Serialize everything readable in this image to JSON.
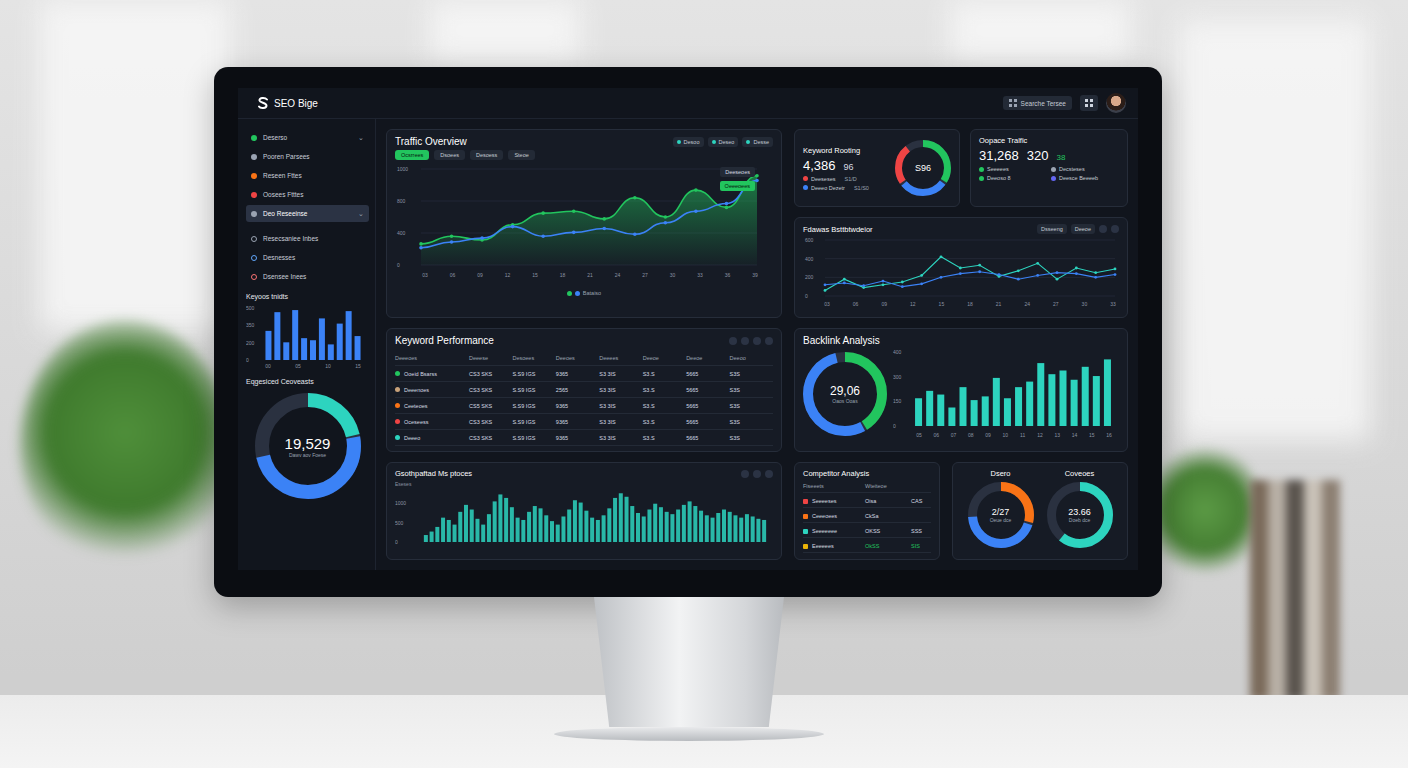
{
  "header": {
    "logo": "SEO Bige",
    "search": "Searche Tersee"
  },
  "sidebar": {
    "nav": [
      {
        "label": "Deserso",
        "color": "#22c55e",
        "selected": false,
        "chevron": "⌄"
      },
      {
        "label": "Pooren Parsees",
        "color": "#9aa3b2",
        "selected": false
      },
      {
        "label": "Reseen Fttes",
        "color": "#f97316",
        "selected": false
      },
      {
        "label": "Oosees Ftttes",
        "color": "#ef4444",
        "selected": false
      },
      {
        "label": "Deo Reseeinse",
        "color": "#9aa3b2",
        "selected": true,
        "chevron": "⌄"
      }
    ],
    "subnav": [
      {
        "label": "Resecsaniee Inbes",
        "color": "#9aa3b2",
        "selected": false
      },
      {
        "label": "Desnesses",
        "color": "#60a5fa",
        "selected": false
      },
      {
        "label": "Dsensee Inees",
        "color": "#f87171",
        "selected": false
      }
    ],
    "keyword_trends": {
      "title": "Keyoos tnidts",
      "y_ticks": [
        "500",
        "350",
        "200",
        "0"
      ],
      "max": 500,
      "values": [
        280,
        460,
        170,
        480,
        210,
        190,
        400,
        150,
        350,
        470,
        230
      ],
      "x_labels": [
        "00",
        "05",
        "10",
        "15"
      ]
    },
    "engaged": {
      "title": "Eqgesiced Ceoveasts",
      "value": "19,529",
      "caption": "Dawv aov Foese",
      "segments": [
        {
          "level": 0.22,
          "color": "#2dd4bf"
        },
        {
          "level": 0.5,
          "color": "#3b82f6"
        }
      ]
    }
  },
  "traffic": {
    "title": "Traffic Overview",
    "tabs": [
      {
        "label": "Ocsrrees",
        "selected": true
      },
      {
        "label": "Dsoees",
        "selected": false
      },
      {
        "label": "Desoess",
        "selected": false
      },
      {
        "label": "Steoe",
        "selected": false
      }
    ],
    "chips": [
      "Desoo",
      "Deseo",
      "Desse"
    ],
    "y_ticks": [
      "1000",
      "800",
      "400",
      "0"
    ],
    "max": 1000,
    "x_labels": [
      "03",
      "06",
      "09",
      "12",
      "15",
      "18",
      "21",
      "24",
      "27",
      "30",
      "33",
      "36",
      "39"
    ],
    "series": [
      {
        "color": "#22c55e",
        "values": [
          220,
          300,
          260,
          420,
          540,
          560,
          480,
          700,
          500,
          780,
          600,
          930
        ]
      },
      {
        "color": "#3b82f6",
        "values": [
          180,
          240,
          280,
          400,
          300,
          340,
          380,
          320,
          440,
          560,
          640,
          880
        ]
      }
    ],
    "tooltip": {
      "label": "Deeseoes",
      "badge": "Oeeeoees"
    },
    "legend": "Bataiso"
  },
  "keyword_ranking": {
    "title": "Keyword Rooting",
    "value": "4,386",
    "delta": "96",
    "rows": [
      {
        "label": "Deeseses",
        "value": "S1/D",
        "color": "#ef4444"
      },
      {
        "label": "Deeeo Dezetr",
        "value": "S1/S0",
        "color": "#3b82f6"
      }
    ],
    "gauge": {
      "value": "S96",
      "segments": [
        {
          "level": 0.35,
          "color": "#22c55e"
        },
        {
          "level": 0.3,
          "color": "#3b82f6"
        },
        {
          "level": 0.25,
          "color": "#ef4444"
        }
      ]
    }
  },
  "organic": {
    "title": "Oopace Tralfic",
    "value": "31,268",
    "sub": "320",
    "delta": "38",
    "rows": [
      {
        "label": "Seeeees",
        "color": "#22c55e"
      },
      {
        "label": "Decsteses",
        "color": "#9aa3b2"
      },
      {
        "label": "Deeoso 8",
        "color": "#22c55e"
      },
      {
        "label": "Deesce Beeeeb",
        "color": "#6366f1"
      }
    ]
  },
  "behavior": {
    "title": "Fdawas Bsttbtwdeior",
    "chips": [
      "Dsseeng",
      "Deeoe"
    ],
    "y_ticks": [
      "600",
      "400",
      "200",
      "0"
    ],
    "max": 600,
    "x_labels": [
      "03",
      "06",
      "09",
      "12",
      "15",
      "18",
      "21",
      "24",
      "27",
      "30",
      "33"
    ],
    "series": [
      {
        "color": "#2dd4bf",
        "values": [
          60,
          180,
          90,
          120,
          150,
          220,
          420,
          300,
          330,
          210,
          270,
          350,
          180,
          300,
          250,
          290
        ]
      },
      {
        "color": "#3b82f6",
        "values": [
          120,
          140,
          110,
          160,
          100,
          130,
          200,
          240,
          260,
          230,
          180,
          220,
          250,
          240,
          200,
          230
        ]
      }
    ]
  },
  "keyword_performance": {
    "title": "Keyword Performance",
    "columns": [
      "Deeeoes",
      "Deeese",
      "Desoees",
      "Deeoes",
      "Deeees",
      "Deeoe",
      "Deeoe",
      "Deeoo"
    ],
    "rows": [
      {
        "color": "#22c55e",
        "cells": [
          "Ooeid Bsarss",
          "CS3 SKS",
          "S.S9 IGS",
          "9365",
          "S3 3IS",
          "S3.S",
          "5665",
          "S3S"
        ]
      },
      {
        "color": "#c8a27a",
        "cells": [
          "Deeenoes",
          "CS3 SKS",
          "S.S9 IGS",
          "2565",
          "S3 3IS",
          "S3.S",
          "5665",
          "S3S"
        ]
      },
      {
        "color": "#f97316",
        "cells": [
          "Ceeteoes",
          "CS5 SKS",
          "S.S9 IGS",
          "9365",
          "S3 3IS",
          "S3.S",
          "5665",
          "S3S"
        ]
      },
      {
        "color": "#ef4444",
        "cells": [
          "Oceseess",
          "CS3 SKS",
          "S.S9 IGS",
          "9365",
          "S3 3IS",
          "S3.S",
          "5665",
          "S3S"
        ]
      },
      {
        "color": "#2dd4bf",
        "cells": [
          "Deeeo",
          "CS3 SKS",
          "S.S9 IGS",
          "9365",
          "S3 3IS",
          "S3.S",
          "5665",
          "S3S"
        ]
      }
    ]
  },
  "backlinks": {
    "title": "Backlink Analysis",
    "donut": {
      "value": "29,06",
      "caption": "Oaos Ooas",
      "segments": [
        {
          "level": 0.42,
          "color": "#22c55e"
        },
        {
          "level": 0.55,
          "color": "#3b82f6"
        }
      ]
    },
    "y_ticks": [
      "400",
      "300",
      "150",
      "0"
    ],
    "max": 400,
    "values": [
      150,
      190,
      170,
      100,
      210,
      140,
      160,
      260,
      150,
      210,
      240,
      340,
      280,
      300,
      250,
      320,
      270,
      360
    ],
    "x_labels": [
      "05",
      "06",
      "07",
      "08",
      "09",
      "10",
      "11",
      "12",
      "13",
      "14",
      "15",
      "16"
    ]
  },
  "visibility": {
    "title": "Gsothpaftad Ms ptoces",
    "y_ticks": [
      "Eseses",
      "1000",
      "500",
      "0"
    ],
    "max": 1000,
    "values": [
      120,
      180,
      260,
      420,
      380,
      300,
      520,
      640,
      560,
      400,
      300,
      480,
      700,
      820,
      760,
      600,
      420,
      380,
      520,
      620,
      580,
      460,
      360,
      300,
      440,
      560,
      720,
      680,
      540,
      420,
      380,
      460,
      580,
      760,
      840,
      780,
      620,
      500,
      440,
      560,
      660,
      600,
      520,
      480,
      560,
      640,
      700,
      620,
      540,
      460,
      420,
      500,
      560,
      520,
      460,
      420,
      480,
      440,
      400,
      380
    ]
  },
  "competitors": {
    "title": "Competitor Analysis",
    "columns": [
      "Fiseeets",
      "Wteiteoe"
    ],
    "rows": [
      {
        "color": "#ef4444",
        "name": "Seeeeses",
        "share": "Oisa",
        "score": "CAS",
        "up": false
      },
      {
        "color": "#f97316",
        "name": "Ceeeoees",
        "share": "CkSa",
        "score": "",
        "up": false
      },
      {
        "color": "#2dd4bf",
        "name": "Seeeeeee",
        "share": "OKSS",
        "score": "SSS",
        "up": false
      },
      {
        "color": "#eab308",
        "name": "Eeeeees",
        "share": "OkSS",
        "score": "SIS",
        "up": true
      }
    ]
  },
  "gauges": [
    {
      "title": "Dsero",
      "value": "2/27",
      "caption": "Oeue dce",
      "segments": [
        {
          "level": 0.3,
          "color": "#f97316"
        },
        {
          "level": 0.45,
          "color": "#3b82f6"
        }
      ]
    },
    {
      "title": "Coveoes",
      "value": "23.66",
      "caption": "Doeb dce",
      "segments": [
        {
          "level": 0.62,
          "color": "#2dd4bf"
        }
      ]
    }
  ]
}
